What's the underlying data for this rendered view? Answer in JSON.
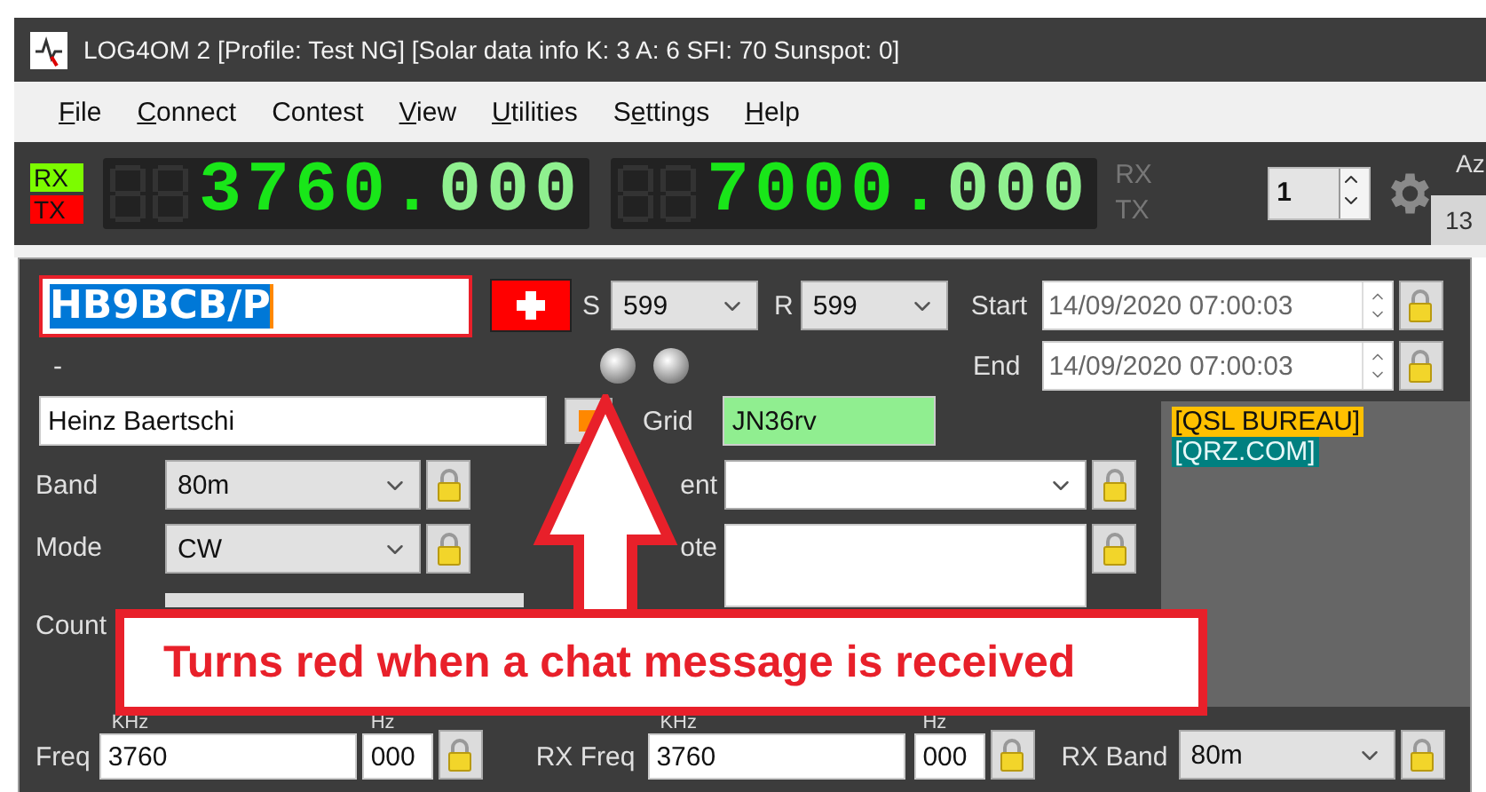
{
  "window": {
    "title": "LOG4OM 2 [Profile: Test NG] [Solar data info K: 3 A: 6 SFI: 70 Sunspot: 0]"
  },
  "menu": [
    {
      "key": "F",
      "after": "ile"
    },
    {
      "key": "C",
      "after": "onnect"
    },
    {
      "before": "Contest"
    },
    {
      "key": "V",
      "after": "iew"
    },
    {
      "key": "U",
      "after": "tilities"
    },
    {
      "before": "S",
      "key": "e",
      "after": "ttings"
    },
    {
      "key": "H",
      "after": "elp"
    }
  ],
  "toolbar": {
    "indicators": [
      {
        "label": "RX",
        "color": "#7cfc00"
      },
      {
        "label": "TX",
        "color": "#ff0000"
      }
    ],
    "displays": [
      {
        "main": "3760.",
        "decimals": "000"
      },
      {
        "main": "7000.",
        "decimals": "000"
      }
    ],
    "display_labels": [
      "RX",
      "TX"
    ],
    "radio_number": "1",
    "azimuth_label": "Az",
    "azimuth_value": "13"
  },
  "qso": {
    "callsign": "HB9BCB/P",
    "s_label": "S",
    "s_report": "599",
    "r_label": "R",
    "r_report": "599",
    "start_label": "Start",
    "start": "14/09/2020 07:00:03",
    "end_label": "End",
    "end": "14/09/2020 07:00:03",
    "dash": "-",
    "leds": [
      {
        "lit": false
      },
      {
        "lit": false
      }
    ],
    "name": "Heinz Baertschi",
    "grid_label": "Grid",
    "grid": "JN36rv",
    "band_label": "Band",
    "band": "80m",
    "comment_label": "ent",
    "mode_label": "Mode",
    "mode": "CW",
    "note_label": "ote",
    "country_label": "Count",
    "qsl_tags": [
      {
        "label": "[QSL BUREAU]",
        "color": "#ffc000"
      },
      {
        "label": "[QRZ.COM]",
        "color": "#008080"
      }
    ],
    "freq_row": {
      "freq_label": "Freq",
      "khz_label": "KHz",
      "hz_label": "Hz",
      "freq": "3760",
      "hz": "000",
      "rx_freq_label": "RX Freq",
      "rx_khz_label": "KHz",
      "rx_hz_label": "Hz",
      "rx_freq": "3760",
      "rx_hz": "000",
      "rx_band_label": "RX Band",
      "rx_band": "80m"
    }
  },
  "annotation": {
    "text": "Turns red when a chat message is received"
  }
}
